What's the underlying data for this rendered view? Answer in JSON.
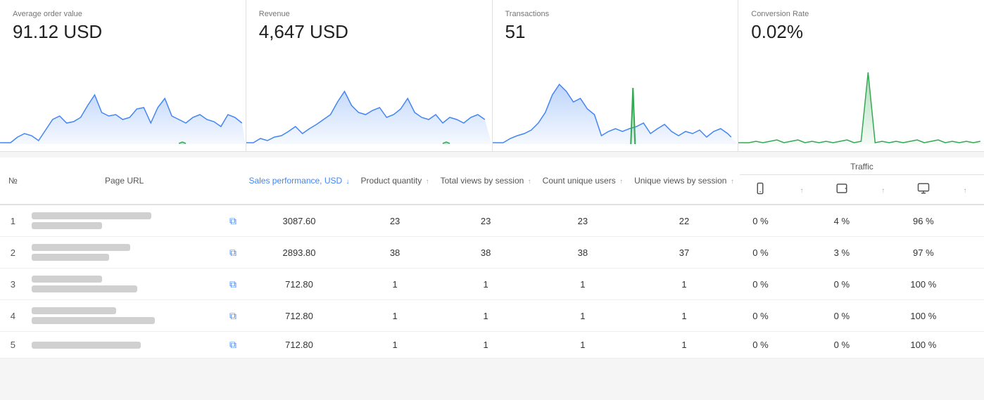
{
  "cards": [
    {
      "label": "Average order value",
      "value": "91.12 USD",
      "color_line": "#4285f4",
      "color_fill": "rgba(66,133,244,0.15)",
      "color_green": "#34a853",
      "id": "aov"
    },
    {
      "label": "Revenue",
      "value": "4,647 USD",
      "color_line": "#4285f4",
      "color_fill": "rgba(66,133,244,0.15)",
      "color_green": "#34a853",
      "id": "revenue"
    },
    {
      "label": "Transactions",
      "value": "51",
      "color_line": "#4285f4",
      "color_fill": "rgba(66,133,244,0.15)",
      "color_green": "#34a853",
      "id": "transactions"
    },
    {
      "label": "Conversion Rate",
      "value": "0.02%",
      "color_line": "#34a853",
      "color_fill": "rgba(52,168,83,0.15)",
      "color_green": "#34a853",
      "id": "conversion"
    }
  ],
  "table": {
    "headers": {
      "no": "№",
      "page_url": "Page URL",
      "sales_performance": "Sales performance, USD",
      "product_quantity": "Product quantity",
      "total_views_by_session": "Total views by session",
      "count_unique_users": "Count unique users",
      "unique_views_by_session": "Unique views by session",
      "traffic": "Traffic"
    },
    "traffic_icons": [
      "mobile",
      "tablet",
      "desktop"
    ],
    "rows": [
      {
        "no": "1",
        "url_bar1_width": 170,
        "url_bar2_width": 100,
        "sales_performance": "3087.60",
        "product_quantity": "23",
        "total_views_by_session": "23",
        "count_unique_users": "23",
        "unique_views_by_session": "22",
        "mobile": "0 %",
        "tablet": "4 %",
        "desktop": "96 %"
      },
      {
        "no": "2",
        "url_bar1_width": 140,
        "url_bar2_width": 110,
        "sales_performance": "2893.80",
        "product_quantity": "38",
        "total_views_by_session": "38",
        "count_unique_users": "38",
        "unique_views_by_session": "37",
        "mobile": "0 %",
        "tablet": "3 %",
        "desktop": "97 %"
      },
      {
        "no": "3",
        "url_bar1_width": 100,
        "url_bar2_width": 150,
        "sales_performance": "712.80",
        "product_quantity": "1",
        "total_views_by_session": "1",
        "count_unique_users": "1",
        "unique_views_by_session": "1",
        "mobile": "0 %",
        "tablet": "0 %",
        "desktop": "100 %"
      },
      {
        "no": "4",
        "url_bar1_width": 120,
        "url_bar2_width": 175,
        "sales_performance": "712.80",
        "product_quantity": "1",
        "total_views_by_session": "1",
        "count_unique_users": "1",
        "unique_views_by_session": "1",
        "mobile": "0 %",
        "tablet": "0 %",
        "desktop": "100 %"
      },
      {
        "no": "5",
        "url_bar1_width": 155,
        "url_bar2_width": 0,
        "sales_performance": "712.80",
        "product_quantity": "1",
        "total_views_by_session": "1",
        "count_unique_users": "1",
        "unique_views_by_session": "1",
        "mobile": "0 %",
        "tablet": "0 %",
        "desktop": "100 %"
      }
    ]
  }
}
